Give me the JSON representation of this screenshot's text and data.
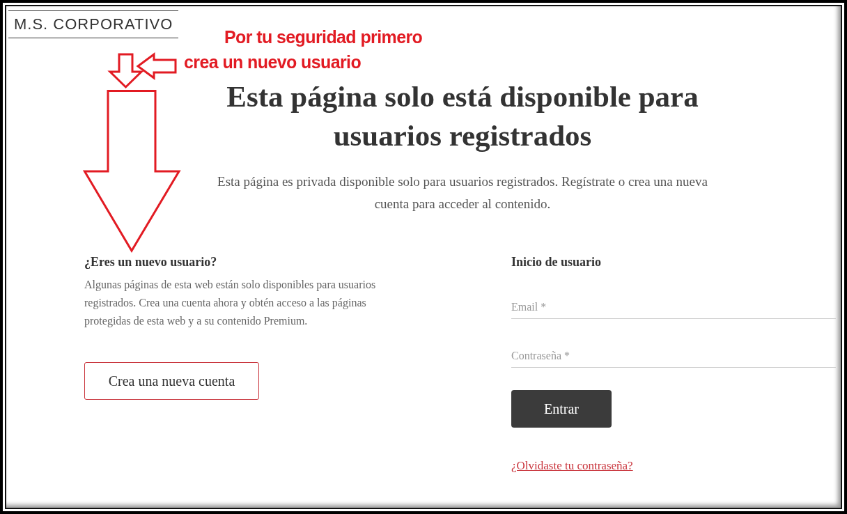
{
  "logo": {
    "text": "M.S. CORPORATIVO"
  },
  "annotation": {
    "lines": [
      "Por tu seguridad primero",
      "crea un nuevo usuario"
    ]
  },
  "hero": {
    "title": "Esta página solo está disponible para usuarios registrados",
    "subtitle": "Esta página es privada disponible solo para usuarios registrados. Regístrate o crea una nueva cuenta para acceder al contenido."
  },
  "new_user": {
    "heading": "¿Eres un nuevo usuario?",
    "text": "Algunas páginas de esta web están solo disponibles para usuarios registrados. Crea una cuenta ahora y obtén acceso a las páginas protegidas de esta web y a su contenido Premium.",
    "button": "Crea una nueva cuenta"
  },
  "login": {
    "heading": "Inicio de usuario",
    "fields": [
      {
        "placeholder": "Email *"
      },
      {
        "placeholder": "Contraseña *"
      }
    ],
    "button": "Entrar",
    "forgot_link": "¿Olvidaste tu contraseña?"
  }
}
